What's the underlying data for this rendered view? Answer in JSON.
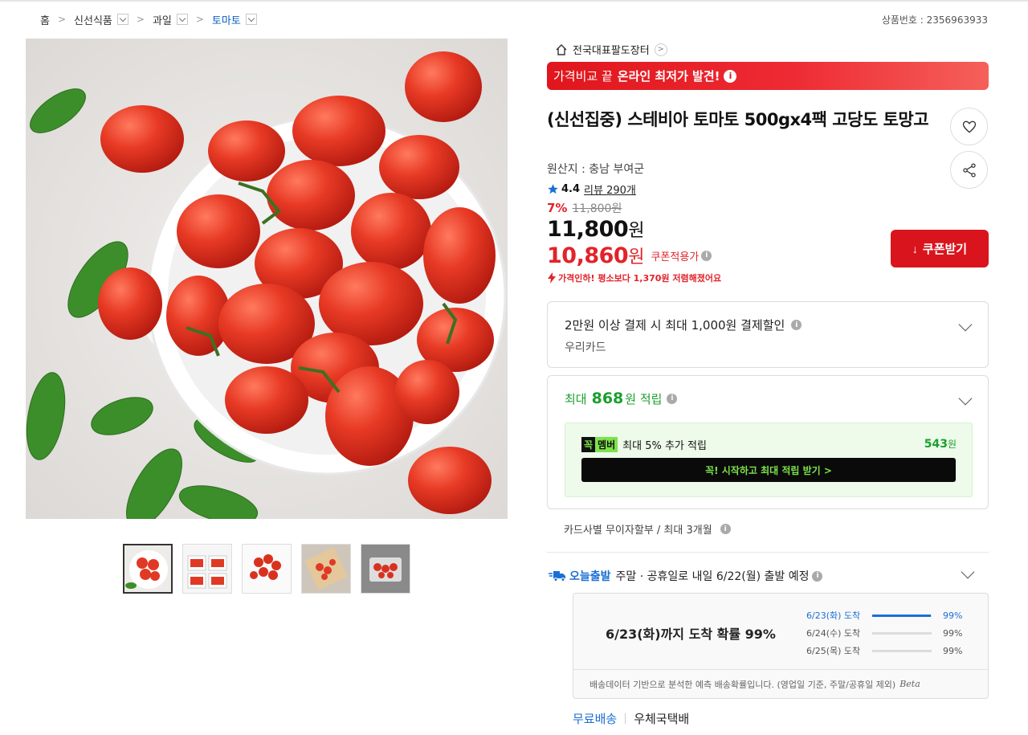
{
  "breadcrumb": {
    "home": "홈",
    "items": [
      "신선식품",
      "과일",
      "토마토"
    ]
  },
  "product_number": "상품번호 : 2356963933",
  "store": {
    "name": "전국대표팔도장터"
  },
  "banner": {
    "prefix": "가격비교 끝",
    "highlight": "온라인 최저가 발견!"
  },
  "product": {
    "title": "(신선집중) 스테비아 토마토 500gx4팩 고당도 토망고",
    "origin": "원산지 : 충남 부여군",
    "rating": "4.4",
    "reviews": "리뷰 290개",
    "discount_rate": "7%",
    "original_price": "11,800원",
    "price": "11,800",
    "price_unit": "원",
    "coupon_price": "10,860",
    "coupon_unit": "원",
    "coupon_tag": "쿠폰적용가",
    "price_drop": "가격인하! 평소보다 1,370원 저렴해졌어요",
    "coupon_button": "쿠폰받기"
  },
  "card_discount": {
    "title": "2만원 이상 결제 시 최대 1,000원 결제할인",
    "card": "우리카드"
  },
  "points": {
    "prefix": "최대",
    "amount": "868",
    "suffix": "원 적립",
    "member_badge_a": "꼭",
    "member_badge_b": "멤버",
    "member_text": "최대 5% 추가 적립",
    "member_points": "543",
    "member_points_unit": "원",
    "cta": "꼭! 시작하고 최대 적립 받기  >"
  },
  "installment": "카드사별 무이자할부 / 최대 3개월",
  "shipping": {
    "tag": "오늘출발",
    "text": "주말 · 공휴일로 내일 6/22(월) 출발 예정",
    "probability_main": "6/23(화)까지 도착 확률 99%",
    "probabilities": [
      {
        "date": "6/23(화) 도착",
        "pct": "99%",
        "value": 99
      },
      {
        "date": "6/24(수) 도착",
        "pct": "99%",
        "value": 0
      },
      {
        "date": "6/25(목) 도착",
        "pct": "99%",
        "value": 0
      }
    ],
    "note": "배송데이터 기반으로 분석한 예측 배송확률입니다. (영업일 기준, 주말/공휴일 제외)",
    "beta": "Beta",
    "free": "무료배송",
    "carrier": "우체국택배"
  },
  "colors": {
    "accent_red": "#d9141c",
    "accent_green": "#1a9f2e",
    "accent_blue": "#1a6fd6"
  }
}
